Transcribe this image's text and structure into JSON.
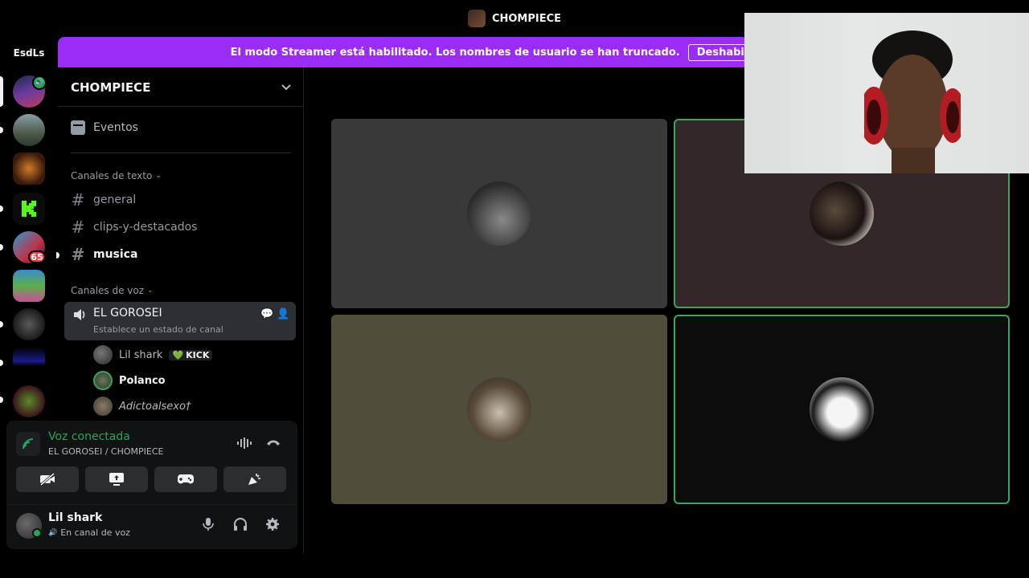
{
  "window": {
    "title": "CHOMPIECE"
  },
  "rail": {
    "top_label": "EsdLs",
    "badge_count": "65"
  },
  "banner": {
    "text": "El modo Streamer está habilitado. Los nombres de usuario se han truncado.",
    "button": "Deshabilit"
  },
  "sidebar": {
    "server_name": "CHOMPIECE",
    "events_label": "Eventos",
    "text_category": "Canales de texto",
    "text_channels": [
      "general",
      "clips-y-destacados",
      "musica"
    ],
    "voice_category": "Canales de voz",
    "voice_channel": {
      "name": "EL GOROSEI",
      "status": "Establece un estado de canal"
    },
    "members": [
      {
        "name": "Lil shark",
        "tag": "KICK"
      },
      {
        "name": "Polanco"
      },
      {
        "name": "Adictoalsexo†"
      }
    ]
  },
  "voice_panel": {
    "title": "Voz conectada",
    "subtitle": "EL GOROSEI / CHOMPIECE"
  },
  "user": {
    "name": "Lil shark",
    "status": "En canal de voz"
  },
  "colors": {
    "accent": "#9b2cf5",
    "connected": "#23a55a",
    "speaking": "#3ba55c"
  }
}
